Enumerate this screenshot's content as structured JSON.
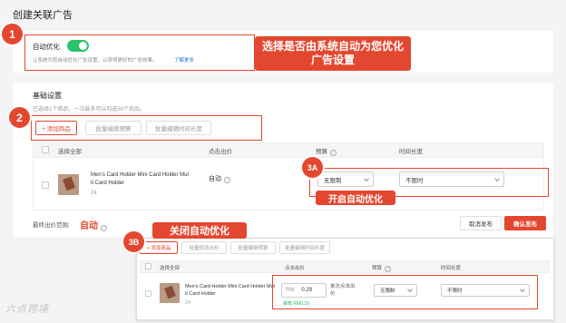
{
  "page": {
    "title": "创建关联广告"
  },
  "auto_optimize": {
    "label": "自动优化",
    "enabled": true,
    "desc": "让系统为您自动优化广告设置，以获得更好的广告效果。",
    "link": "了解更多"
  },
  "annotations": {
    "badge1": "1",
    "badge2": "2",
    "badge3a": "3A",
    "badge3b": "3B",
    "callout1_line1": "选择是否由系统自动为您优化",
    "callout1_line2": "广告设置",
    "callout3a": "开启自动优化",
    "callout3b": "关闭自动优化",
    "accent_color": "#e4472f"
  },
  "basic": {
    "title": "基础设置",
    "desc": "已选择1个商品，一次最多可以勾选50个商品。",
    "buttons": {
      "add": "+ 添加商品",
      "batch_budget": "批量编辑预算",
      "batch_duration": "批量编辑时间长度"
    },
    "columns": {
      "select_all": "选择全部",
      "bid": "点击出价",
      "budget": "预算",
      "duration": "时间长度"
    },
    "row": {
      "name_line1": "Men's Card Holder Mini Card Holder Mul",
      "name_line2": "ti Card Holder",
      "id": "24",
      "bid": "自动",
      "budget": "无限制",
      "duration": "不限时"
    },
    "final_label": "最终出价范围:",
    "final_value": "自动",
    "cancel": "取消发布",
    "confirm": "确认发布"
  },
  "manual": {
    "buttons": {
      "add": "+ 添加商品",
      "batch_bid": "批量修改出价",
      "batch_budget": "批量编辑预算",
      "batch_duration": "批量编辑时间长度"
    },
    "columns": {
      "select_all": "选择全部",
      "bid": "点击出价",
      "budget": "预算",
      "duration": "时间长度"
    },
    "row": {
      "name_line1": "Men's Card Holder Mini Card Holder Mul",
      "name_line2": "ti Card Holder",
      "id": "24",
      "bid_prefix": "RM",
      "bid_value": "0.29",
      "bid_hint_line1": "单次点击出",
      "bid_hint_line2": "价",
      "suggest": "推荐 RM0.29",
      "budget": "无限制",
      "duration": "不限时"
    }
  },
  "watermark": "六点跨境"
}
